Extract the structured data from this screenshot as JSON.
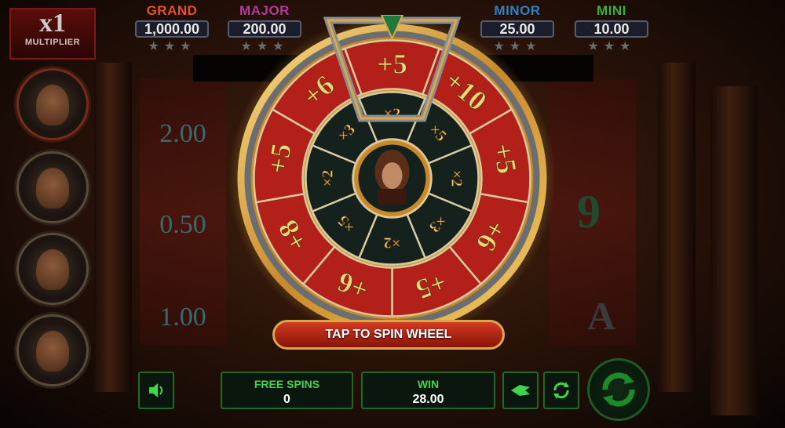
{
  "multiplier": {
    "value": "x1",
    "label": "MULTIPLIER"
  },
  "jackpots": [
    {
      "name": "GRAND",
      "value": "1,000.00",
      "color": "#e9541c"
    },
    {
      "name": "MAJOR",
      "value": "200.00",
      "color": "#b73b9a"
    },
    {
      "name": "MINOR",
      "value": "25.00",
      "color": "#2e83c7"
    },
    {
      "name": "MINI",
      "value": "10.00",
      "color": "#3fae3a"
    }
  ],
  "jackpot_stars": "★★★",
  "reel_values": [
    "2.00",
    "0.50",
    "1.00"
  ],
  "reel_symbols": [
    "9",
    "A"
  ],
  "wheel": {
    "outer": [
      "+5",
      "+10",
      "+5",
      "+6",
      "+5",
      "+6",
      "+8",
      "+5",
      "+6"
    ],
    "inner": [
      "×2",
      "×5",
      "×2",
      "×3",
      "×2",
      "×5",
      "×2",
      "×3"
    ]
  },
  "spin_wheel_label": "TAP TO SPIN WHEEL",
  "free_spins": {
    "label": "FREE SPINS",
    "value": "0"
  },
  "win": {
    "label": "WIN",
    "value": "28.00"
  },
  "colors": {
    "wheel_red": "#b3201a",
    "gold": "#d9a84a",
    "ui_green": "#3fd44b",
    "wheel_dark": "#14211c"
  }
}
